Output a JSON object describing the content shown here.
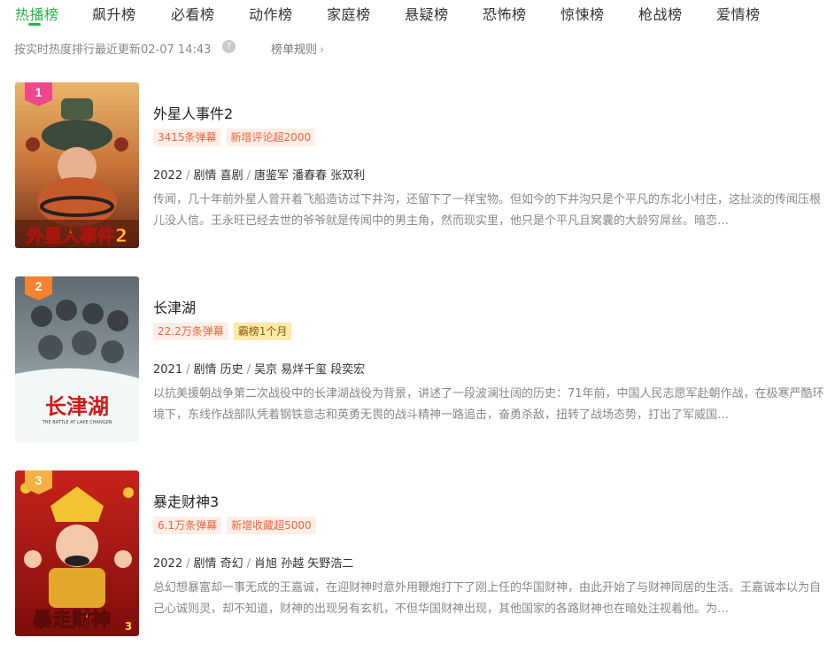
{
  "tabs": [
    {
      "label": "热播榜",
      "active": true
    },
    {
      "label": "飙升榜",
      "active": false
    },
    {
      "label": "必看榜",
      "active": false
    },
    {
      "label": "动作榜",
      "active": false
    },
    {
      "label": "家庭榜",
      "active": false
    },
    {
      "label": "悬疑榜",
      "active": false
    },
    {
      "label": "恐怖榜",
      "active": false
    },
    {
      "label": "惊悚榜",
      "active": false
    },
    {
      "label": "枪战榜",
      "active": false
    },
    {
      "label": "爱情榜",
      "active": false
    }
  ],
  "subbar": {
    "update_text": "按实时热度排行最近更新02-07 14:43",
    "rules_label": "榜单规则"
  },
  "colors": {
    "accent": "#2ab34a",
    "tag_text": "#f0643c",
    "tag_bg": "#fdeee8",
    "gold_tag_bg": "#fde9a8"
  },
  "items": [
    {
      "rank": "1",
      "title": "外星人事件2",
      "tags": [
        "3415条弹幕",
        "新增评论超2000"
      ],
      "year": "2022",
      "genres": "剧情 喜剧",
      "cast": "唐鉴军 潘春春 张双利",
      "description": "传闻，几十年前外星人曾开着飞船造访过下井沟，还留下了一样宝物。但如今的下井沟只是个平凡的东北小村庄，这扯淡的传闻压根儿没人信。王永旺已经去世的爷爷就是传闻中的男主角，然而现实里，他只是个平凡且窝囊的大龄穷屌丝。暗恋…",
      "poster_text": "外星人事件2"
    },
    {
      "rank": "2",
      "title": "长津湖",
      "tags": [
        "22.2万条弹幕",
        "霸榜1个月"
      ],
      "year": "2021",
      "genres": "剧情 历史",
      "cast": "吴京 易烊千玺 段奕宏",
      "description": "以抗美援朝战争第二次战役中的长津湖战役为背景，讲述了一段波澜壮阔的历史：71年前，中国人民志愿军赴朝作战，在极寒严酷环境下，东线作战部队凭着钢铁意志和英勇无畏的战斗精神一路追击，奋勇杀敌，扭转了战场态势，打出了军威国…",
      "poster_text": "长津湖",
      "poster_subtext": "THE BATTLE AT LAKE CHANGJIN"
    },
    {
      "rank": "3",
      "title": "暴走财神3",
      "tags": [
        "6.1万条弹幕",
        "新增收藏超5000"
      ],
      "year": "2022",
      "genres": "剧情 奇幻",
      "cast": "肖旭 孙越 矢野浩二",
      "description": "总幻想暴富却一事无成的王嘉诚，在迎财神时意外用鞭炮打下了刚上任的华国财神，由此开始了与财神同居的生活。王嘉诚本以为自己心诚则灵，却不知道，财神的出现另有玄机，不但华国财神出现，其他国家的各路财神也在暗处注视着他。为…",
      "poster_text": "暴走财神",
      "poster_number": "3"
    }
  ]
}
